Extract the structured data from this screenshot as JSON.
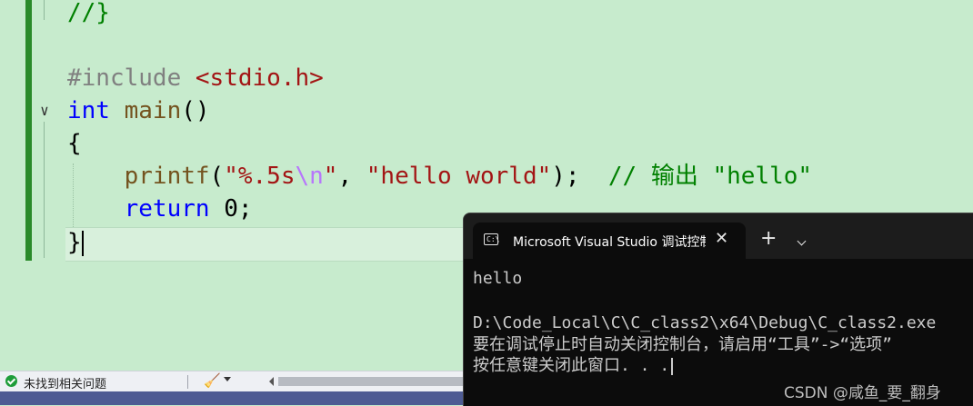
{
  "editor": {
    "lines": [
      {
        "parts": [
          "//}"
        ]
      },
      {
        "parts": [
          "#include",
          "<stdio.h>"
        ]
      },
      {
        "parts": [
          "int",
          "main",
          "()"
        ]
      },
      {
        "parts": [
          "{"
        ]
      },
      {
        "parts": [
          "printf",
          "(",
          "\"%.5s",
          "\\n",
          "\"",
          ", ",
          "\"hello world\"",
          ");",
          "// 输出 \"hello\""
        ]
      },
      {
        "parts": [
          "return",
          " 0;"
        ]
      },
      {
        "parts": [
          "}"
        ]
      }
    ]
  },
  "statusbar": {
    "issues_text": "未找到相关问题",
    "status_icon": "check-circle-icon",
    "cleanup_icon": "broom-icon"
  },
  "terminal": {
    "tab_title": "Microsoft Visual Studio 调试控制台",
    "tab_close": "✕",
    "new_tab": "+",
    "output": [
      "hello",
      "",
      "D:\\Code_Local\\C\\C_class2\\x64\\Debug\\C_class2.exe",
      "要在调试停止时自动关闭控制台，请启用“工具”->“选项”",
      "按任意键关闭此窗口. . ."
    ]
  },
  "watermark": "CSDN @咸鱼_要_翻身",
  "colors": {
    "editor_bg": "#c7ebcd",
    "keyword": "#0000ff",
    "function": "#74531f",
    "string": "#a31515",
    "comment": "#008000",
    "terminal_bg": "#0c0c0c"
  }
}
